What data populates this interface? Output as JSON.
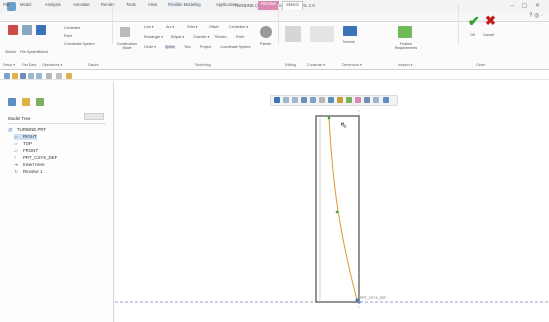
{
  "window": {
    "title": "TURBINE (Active) - Creo Parametric 2.0",
    "controls": "– ▢ ✕"
  },
  "menu": {
    "tabs": [
      "File",
      "Model",
      "Analysis",
      "Annotate",
      "Render",
      "Tools",
      "View",
      "Flexible Modeling",
      "Applications",
      "Revolve",
      "Sketch"
    ],
    "right": "? ◎ ·"
  },
  "ribbon": {
    "setup": {
      "items": [
        "Sketch",
        "File System",
        "Select"
      ],
      "label": "Setup ▾"
    },
    "get_data": {
      "label": "Get Data"
    },
    "operations": {
      "label": "Operations ▾"
    },
    "datum": {
      "items": [
        "Centerline",
        "Point",
        "Coordinate System"
      ],
      "label": "Datum"
    },
    "construction": {
      "items": [
        "Construction Mode"
      ]
    },
    "sketching": {
      "items": [
        "Line ▾",
        "Arc ▾",
        "Fillet ▾",
        "Offset",
        "Centerline ▾",
        "Rectangle ▾",
        "Ellipse ▾",
        "Chamfer ▾",
        "Thicken",
        "Point",
        "Circle ▾",
        "Spline",
        "Text",
        "Project",
        "Coordinate System",
        "Palette"
      ],
      "label": "Sketching"
    },
    "editing": {
      "label": "Editing"
    },
    "constrain": {
      "label": "Constrain ▾"
    },
    "dimension": {
      "items": [
        "Normal"
      ],
      "label": "Dimension ▾"
    },
    "inspect": {
      "items": [
        "Feature Requirements"
      ],
      "label": "Inspect ▾"
    },
    "close": {
      "items": [
        "OK",
        "Cancel"
      ],
      "label": "Close"
    }
  },
  "model_tree": {
    "label": "Model Tree",
    "items": [
      {
        "icon": "part-icon",
        "label": "TURBINE.PRT"
      },
      {
        "icon": "plane-icon",
        "label": "RIGHT"
      },
      {
        "icon": "plane-icon",
        "label": "TOP"
      },
      {
        "icon": "plane-icon",
        "label": "FRONT"
      },
      {
        "icon": "csys-icon",
        "label": "PRT_CSYS_DEF"
      },
      {
        "icon": "insert-icon",
        "label": "Insert Here"
      },
      {
        "icon": "revolve-icon",
        "label": "Revolve 1"
      }
    ]
  },
  "graphics": {
    "csys_label": "PRT_CSYS_DEF"
  },
  "colors": {
    "accent": "#d88ab2",
    "sketch_line": "#e09a3b",
    "geometry": "#5a5a5a",
    "ok": "#2f9e2f",
    "cancel": "#c41d1d",
    "tree_icon": "#5a8ec4"
  }
}
